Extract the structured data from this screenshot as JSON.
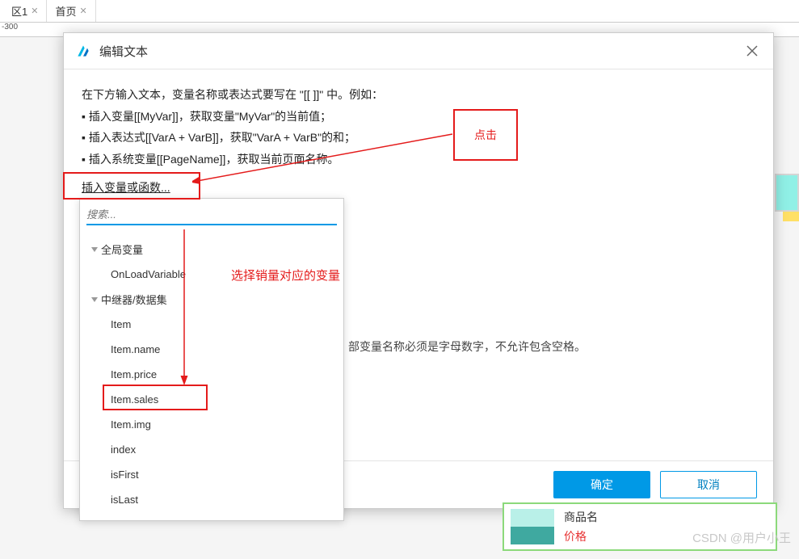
{
  "tabs": [
    {
      "label": "区1"
    },
    {
      "label": "首页"
    }
  ],
  "ruler": "-300",
  "modal": {
    "title": "编辑文本",
    "instructions": {
      "lead": "在下方输入文本，变量名称或表达式要写在 \"[[ ]]\" 中。例如：",
      "b1": "▪ 插入变量[[MyVar]]，获取变量\"MyVar\"的当前值；",
      "b2": "▪ 插入表达式[[VarA + VarB]]，获取\"VarA + VarB\"的和；",
      "b3": "▪ 插入系统变量[[PageName]]，获取当前页面名称。"
    },
    "insertLink": "插入变量或函数...",
    "hint": "部变量名称必须是字母数字，不允许包含空格。",
    "ok": "确定",
    "cancel": "取消"
  },
  "dropdown": {
    "searchPlaceholder": "搜索...",
    "cat1": "全局变量",
    "items1": [
      "OnLoadVariable"
    ],
    "cat2": "中继器/数据集",
    "items2": [
      "Item",
      "Item.name",
      "Item.price",
      "Item.sales",
      "Item.img",
      "index",
      "isFirst",
      "isLast"
    ]
  },
  "annotations": {
    "clickLabel": "点击",
    "selectLabel": "选择销量对应的变量"
  },
  "bgCard": {
    "title": "商品名",
    "price": "价格"
  },
  "watermark": "CSDN @用户小王"
}
